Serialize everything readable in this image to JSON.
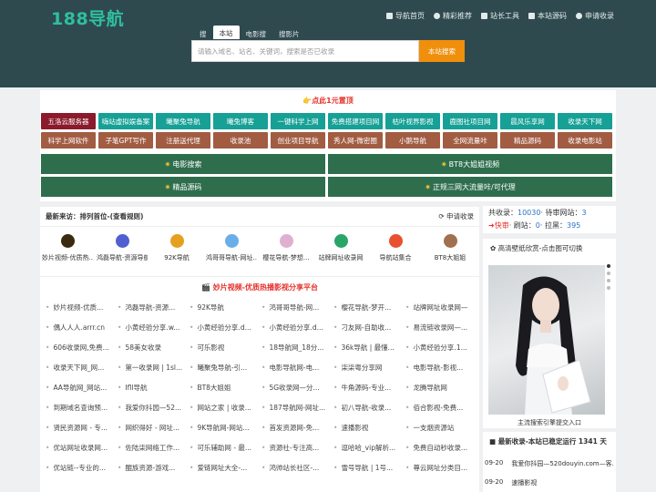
{
  "site": {
    "logo": "188导航"
  },
  "topnav": [
    {
      "label": "导航首页",
      "icon": "home-icon"
    },
    {
      "label": "精彩推荐",
      "icon": "heart-icon"
    },
    {
      "label": "站长工具",
      "icon": "wrench-icon"
    },
    {
      "label": "本站源码",
      "icon": "code-icon"
    },
    {
      "label": "申请收录",
      "icon": "refresh-icon"
    }
  ],
  "search": {
    "tabs": [
      "搜",
      "本站",
      "电影搜",
      "搜影片"
    ],
    "placeholder": "请输入域名、站名、关键词，搜索是否已收录",
    "button": "本站搜索"
  },
  "hot": {
    "title": "点此1元置顶",
    "row1": [
      {
        "label": "五洛云服务器",
        "color": "#8b1a2c"
      },
      {
        "label": "嗨站虚拟娱备案",
        "color": "#16a096"
      },
      {
        "label": "曦聚兔导航",
        "color": "#16a096"
      },
      {
        "label": "曦兔博客",
        "color": "#16a096"
      },
      {
        "label": "一键科学上网",
        "color": "#16a096"
      },
      {
        "label": "免费搭建项目网",
        "color": "#16a096"
      },
      {
        "label": "枯叶视界影视",
        "color": "#16a096"
      },
      {
        "label": "鹿图社项目网",
        "color": "#16a096"
      },
      {
        "label": "晨风乐享网",
        "color": "#16a096"
      },
      {
        "label": "收录天下网",
        "color": "#16a096"
      }
    ],
    "row2": [
      {
        "label": "科学上网软件",
        "color": "#a25c42"
      },
      {
        "label": "子笔GPT写作",
        "color": "#a25c42"
      },
      {
        "label": "注册送代理",
        "color": "#a25c42"
      },
      {
        "label": "收录池",
        "color": "#a25c42"
      },
      {
        "label": "创业项目导航",
        "color": "#a25c42"
      },
      {
        "label": "秀人网-微密圈",
        "color": "#a25c42"
      },
      {
        "label": "小鹅导航",
        "color": "#a25c42"
      },
      {
        "label": "全网流量咔",
        "color": "#a25c42"
      },
      {
        "label": "精品源码",
        "color": "#a25c42"
      },
      {
        "label": "收录电影站",
        "color": "#a25c42"
      }
    ],
    "big": [
      "电影搜索",
      "BT8大姐姐视频",
      "精品源码",
      "正规三网大流量咔/可代理"
    ]
  },
  "recent": {
    "title": "最新来访：排列首位-(查看规则)",
    "apply": "申请收录",
    "items": [
      {
        "name": "妙片视频-优质热...",
        "color": "#3a2a10"
      },
      {
        "name": "鸿磊导航-资源导航",
        "color": "#5060d0"
      },
      {
        "name": "92K导航",
        "color": "#e6a020"
      },
      {
        "name": "鸿哥哥导航-网址...",
        "color": "#6aaee8"
      },
      {
        "name": "樱花导航-梦想...",
        "color": "#e0b0d0"
      },
      {
        "name": "站牌网址收录网",
        "color": "#2aa56a"
      },
      {
        "name": "导航站集合",
        "color": "#e85030"
      },
      {
        "name": "BT8大姐姐",
        "color": "#a07050"
      }
    ]
  },
  "listing": {
    "title": "妙片视频-优质热播影视分享平台",
    "items": [
      "妙片视频-优质...",
      "鸿磊导航-资源...",
      "92K导航",
      "鸿哥哥导航-网...",
      "樱花导航-梦开...",
      "站牌网址收录网—",
      "偶人人人.arrr.cn",
      "小黄经验分享.w...",
      "小黄经验分享.d...",
      "小黄经验分享.d...",
      "刁友网-自助收...",
      "易流链收录网—...",
      "606收录网,免费...",
      "58美女收录",
      "可乐影视",
      "18导航网_18分...",
      "36k导航 | 最懂...",
      "小黄经验分享.1...",
      "收录天下网_网...",
      "第一收录网 | 1sl...",
      "曦聚兔导航-引...",
      "电影导航网-电...",
      "柒柒粤分享网",
      "电影导航-影视...",
      "AA导航网_网站...",
      "Ifll导航",
      "BT8大姐姐",
      "5G收录网—分...",
      "牛角源码-专业...",
      "龙腾导航网",
      "到期域名查询预...",
      "我爱你抖园—52...",
      "网站之家 | 收录...",
      "187导航网-网址...",
      "初八导航-收录...",
      "佰合影视-免费...",
      "贤民资源网 - 专...",
      "网织得好 - 网址...",
      "9K导航网-网站...",
      "首发资源网-免...",
      "速播影视",
      "一支烟资源站",
      "优站网址收录网...",
      "佐陆柒网络工作...",
      "可乐辅助网 - 最...",
      "资源社-专注高...",
      "逗哈哈_vip解析...",
      "免费自动秒收录...",
      "优站链--专业的...",
      "醌族资源-游戏...",
      "爱链网址大全-...",
      "鸿帅站长社区-...",
      "雪号导航 | 1号...",
      "尊云网址分类目..."
    ]
  },
  "stats": {
    "label1": "共收录：",
    "count1": "10030",
    "label2": "· 待审网站：",
    "count2": "3",
    "label3": "快审",
    "label4": "· 刷站：",
    "count4": "0",
    "label5": "· 拉黑：",
    "count5": "395"
  },
  "wallpaper": {
    "title": "高清壁纸欣赏-点击图可切换",
    "caption": "主流搜索引擎提交入口"
  },
  "news": {
    "title": "最新收录-本站已稳定运行 1341 天",
    "items": [
      {
        "date": "09-20",
        "text": "我爱你抖园—520douyin.com—客..."
      },
      {
        "date": "09-20",
        "text": "速播影视"
      }
    ]
  }
}
